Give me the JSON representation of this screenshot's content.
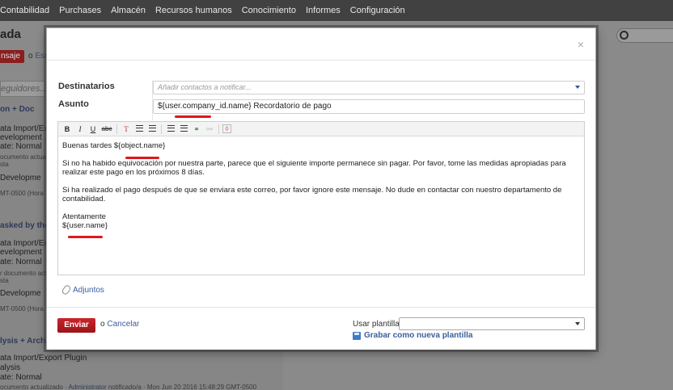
{
  "nav": {
    "items": [
      "Contabilidad",
      "Purchases",
      "Almacén",
      "Recursos humanos",
      "Conocimiento",
      "Informes",
      "Configuración"
    ]
  },
  "background": {
    "title": "ada",
    "button_label": "nsaje",
    "or_text": "o",
    "link_text": "Esc",
    "follow_placeholder": "eguidores...",
    "entries": [
      "on + Doc",
      "ata Import/Exp",
      "evelopment",
      "ate: Normal",
      "ocumento actuali",
      "sta",
      " Developme",
      "MT-0500 (Hora",
      "asked by the",
      "ata Import/Exp",
      "evelopment",
      "ate: Normal",
      "r documento actuali",
      "sta",
      " Developme",
      "MT-0500 (Hora",
      "lysis + Archi",
      "ata Import/Export Plugin",
      "alysis",
      "ate: Normal",
      "ocumento actualizado · ",
      "Administrator",
      " notificado/a · Mon Jun 20 2016 15:48:29 GMT-0500"
    ]
  },
  "modal": {
    "close_icon": "×",
    "recipients_label": "Destinatarios",
    "recipients_placeholder": "Añadir contactos a notificar...",
    "subject_label": "Asunto",
    "subject_value": "${user.company_id.name} Recordatorio de pago",
    "toolbar": {
      "bold": "B",
      "italic": "I",
      "underline": "U",
      "strike": "abc"
    },
    "body": {
      "greeting": "Buenas tardes  ${object.name}",
      "p1": "Si no ha habido equivocación por nuestra parte, parece que el siguiente importe permanece sin pagar. Por favor, tome las medidas apropiadas para realizar este pago en los próximos 8 días.",
      "p2": "Si ha realizado el pago después de que se enviara este correo, por favor ignore este mensaje. No dude en contactar con nuestro departamento de contabilidad.",
      "closing": "Atentamente",
      "signature": "${user.name}"
    },
    "attachments_label": "Adjuntos",
    "send_label": "Enviar",
    "or_text": "o",
    "cancel_label": "Cancelar",
    "template_label": "Usar plantilla",
    "template_value": "",
    "save_template_label": "Grabar como nueva plantilla"
  },
  "colors": {
    "send_button": "#b71c22",
    "link": "#3b5ea0",
    "annotation_underline": "#e0161c",
    "topbar": "#414141"
  }
}
